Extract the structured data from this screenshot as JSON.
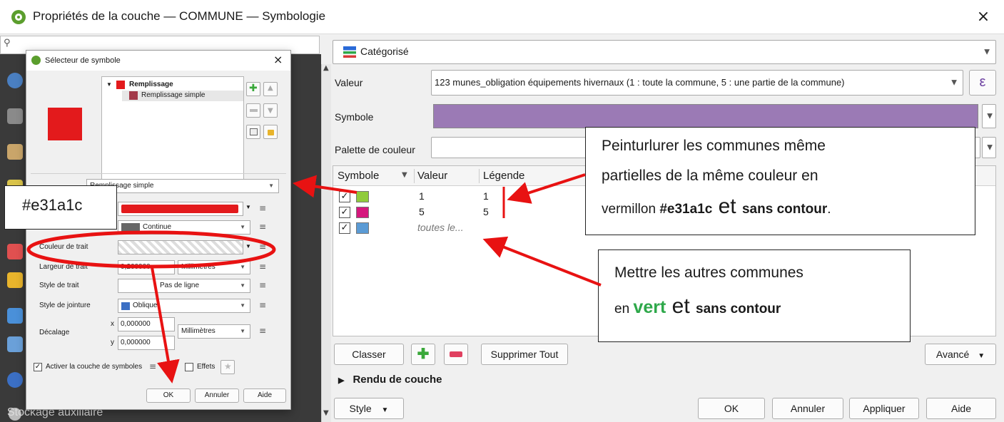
{
  "window": {
    "title": "Propriétés de la couche — COMMUNE — Symbologie",
    "close": "×"
  },
  "left_panel": {
    "search_placeholder": "",
    "bottom_item": "Stockage auxiliaire"
  },
  "renderer": {
    "type_label": "Catégorisé",
    "value_label": "Valeur",
    "value_field": "123 munes_obligation équipements hivernaux (1 : toute la commune, 5 : une partie de la commune)",
    "expression_icon": "ε",
    "symbol_label": "Symbole",
    "symbol_color": "#9b7ab5",
    "palette_label": "Palette de couleur"
  },
  "table": {
    "headers": [
      "Symbole",
      "Valeur",
      "Légende"
    ],
    "rows": [
      {
        "checked": "✓",
        "color": "#8fcb3c",
        "value": "1",
        "legend": "1"
      },
      {
        "checked": "✓",
        "color": "#d5177d",
        "value": "5",
        "legend": "5"
      },
      {
        "checked": "✓",
        "color": "#5b9bd5",
        "value": "toutes le...",
        "legend": ""
      }
    ]
  },
  "buttons": {
    "classify": "Classer",
    "delete_all": "Supprimer Tout",
    "advanced": "Avancé",
    "layer_rendering": "Rendu de couche",
    "style": "Style",
    "ok": "OK",
    "cancel": "Annuler",
    "apply": "Appliquer",
    "help": "Aide"
  },
  "symbol_dialog": {
    "title": "Sélecteur de symbole",
    "close": "×",
    "preview_color": "#e31a1c",
    "tree": {
      "parent": "Remplissage",
      "child": "Remplissage simple"
    },
    "layer_type_value": "Remplissage simple",
    "stroke_style_value": "Continue",
    "stroke_color_label": "Couleur de trait",
    "stroke_width_label": "Largeur de trait",
    "stroke_width_value": "0,260000",
    "stroke_width_unit": "Millimètres",
    "stroke_style_label": "Style de trait",
    "stroke_style_combo": "Pas de ligne",
    "join_style_label": "Style de jointure",
    "join_style_value": "Oblique",
    "offset_label": "Décalage",
    "offset_x_label": "x",
    "offset_x": "0,000000",
    "offset_y_label": "y",
    "offset_y": "0,000000",
    "offset_unit": "Millimètres",
    "enable_layer": "Activer la couche de symboles",
    "effects": "Effets",
    "ok": "OK",
    "cancel": "Annuler",
    "help": "Aide"
  },
  "annotations": {
    "hex_box": "#e31a1c",
    "callout1_line1": "Peinturlurer les communes même",
    "callout1_line2": "partielles de la même couleur en",
    "callout1_line3a": "vermillon ",
    "callout1_hex": "#e31a1c",
    "callout1_et": " et ",
    "callout1_bold": "sans contour",
    "callout1_end": ".",
    "callout2_line1": "Mettre les autres communes",
    "callout2_en": "en ",
    "callout2_vert": "vert",
    "callout2_et": " et ",
    "callout2_bold": "sans contour",
    "arrow_color": "#e81212",
    "green_text_color": "#2ea84a"
  }
}
